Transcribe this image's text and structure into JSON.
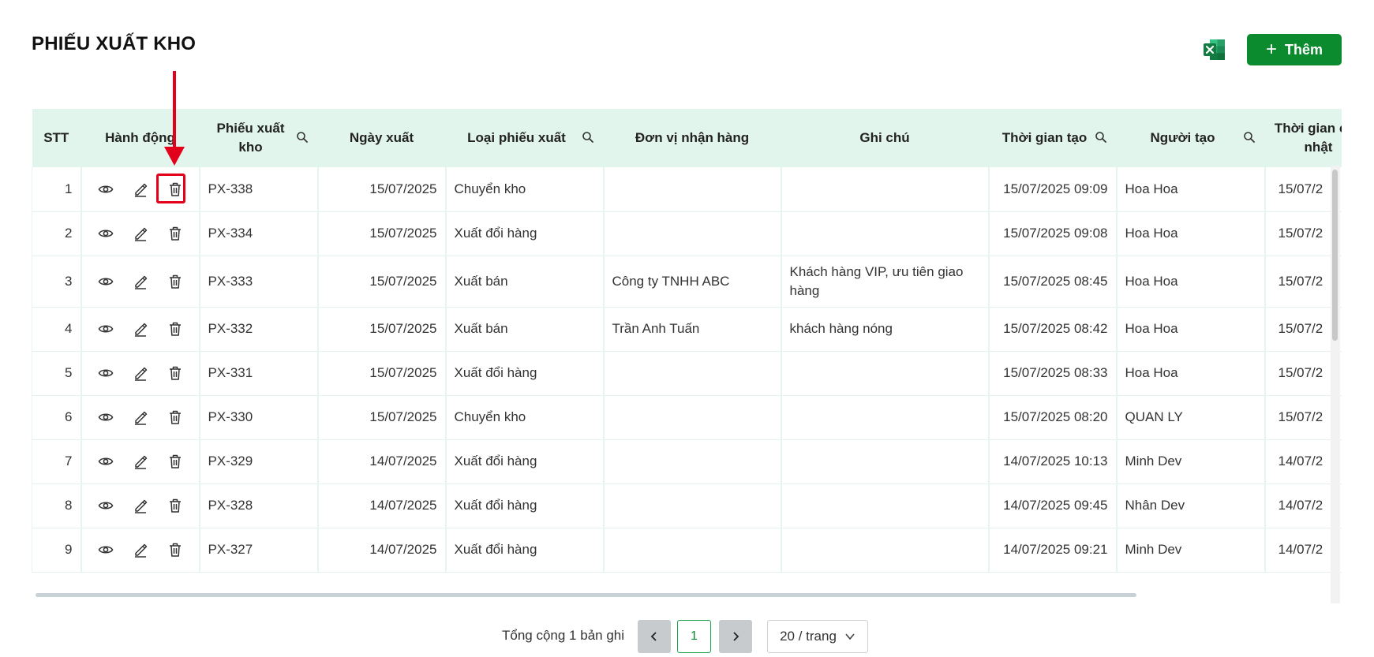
{
  "page": {
    "title": "PHIẾU XUẤT KHO"
  },
  "toolbar": {
    "excel_icon": "excel-icon",
    "add_label": "Thêm",
    "brand_color": "#0c8a2e"
  },
  "table": {
    "headers": {
      "stt": "STT",
      "actions": "Hành động",
      "code": "Phiếu xuất kho",
      "date": "Ngày xuất",
      "type": "Loại phiếu xuất",
      "receiver": "Đơn vị nhận hàng",
      "note": "Ghi chú",
      "created_at": "Thời gian tạo",
      "creator": "Người tạo",
      "updated_at": "Thời gian cập nhật"
    },
    "rows": [
      {
        "stt": "1",
        "code": "PX-338",
        "date": "15/07/2025",
        "type": "Chuyển kho",
        "receiver": "",
        "note": "",
        "created_at": "15/07/2025 09:09",
        "creator": "Hoa Hoa",
        "updated_at": "15/07/2"
      },
      {
        "stt": "2",
        "code": "PX-334",
        "date": "15/07/2025",
        "type": "Xuất đổi hàng",
        "receiver": "",
        "note": "",
        "created_at": "15/07/2025 09:08",
        "creator": "Hoa Hoa",
        "updated_at": "15/07/2"
      },
      {
        "stt": "3",
        "code": "PX-333",
        "date": "15/07/2025",
        "type": "Xuất bán",
        "receiver": "Công ty TNHH ABC",
        "note": "Khách hàng VIP, ưu tiên giao hàng",
        "created_at": "15/07/2025 08:45",
        "creator": "Hoa Hoa",
        "updated_at": "15/07/2"
      },
      {
        "stt": "4",
        "code": "PX-332",
        "date": "15/07/2025",
        "type": "Xuất bán",
        "receiver": "Trần Anh Tuấn",
        "note": "khách hàng nóng",
        "created_at": "15/07/2025 08:42",
        "creator": "Hoa Hoa",
        "updated_at": "15/07/2"
      },
      {
        "stt": "5",
        "code": "PX-331",
        "date": "15/07/2025",
        "type": "Xuất đổi hàng",
        "receiver": "",
        "note": "",
        "created_at": "15/07/2025 08:33",
        "creator": "Hoa Hoa",
        "updated_at": "15/07/2"
      },
      {
        "stt": "6",
        "code": "PX-330",
        "date": "15/07/2025",
        "type": "Chuyển kho",
        "receiver": "",
        "note": "",
        "created_at": "15/07/2025 08:20",
        "creator": "QUAN LY",
        "updated_at": "15/07/2"
      },
      {
        "stt": "7",
        "code": "PX-329",
        "date": "14/07/2025",
        "type": "Xuất đổi hàng",
        "receiver": "",
        "note": "",
        "created_at": "14/07/2025 10:13",
        "creator": "Minh Dev",
        "updated_at": "14/07/2"
      },
      {
        "stt": "8",
        "code": "PX-328",
        "date": "14/07/2025",
        "type": "Xuất đổi hàng",
        "receiver": "",
        "note": "",
        "created_at": "14/07/2025 09:45",
        "creator": "Nhân Dev",
        "updated_at": "14/07/2"
      },
      {
        "stt": "9",
        "code": "PX-327",
        "date": "14/07/2025",
        "type": "Xuất đổi hàng",
        "receiver": "",
        "note": "",
        "created_at": "14/07/2025 09:21",
        "creator": "Minh Dev",
        "updated_at": "14/07/2"
      }
    ],
    "row_icons": [
      "eye-icon",
      "edit-icon",
      "trash-icon"
    ]
  },
  "pagination": {
    "total_text": "Tổng cộng 1 bản ghi",
    "current_page": "1",
    "page_size": "20 / trang"
  },
  "annotation": {
    "color": "#e3001b"
  }
}
